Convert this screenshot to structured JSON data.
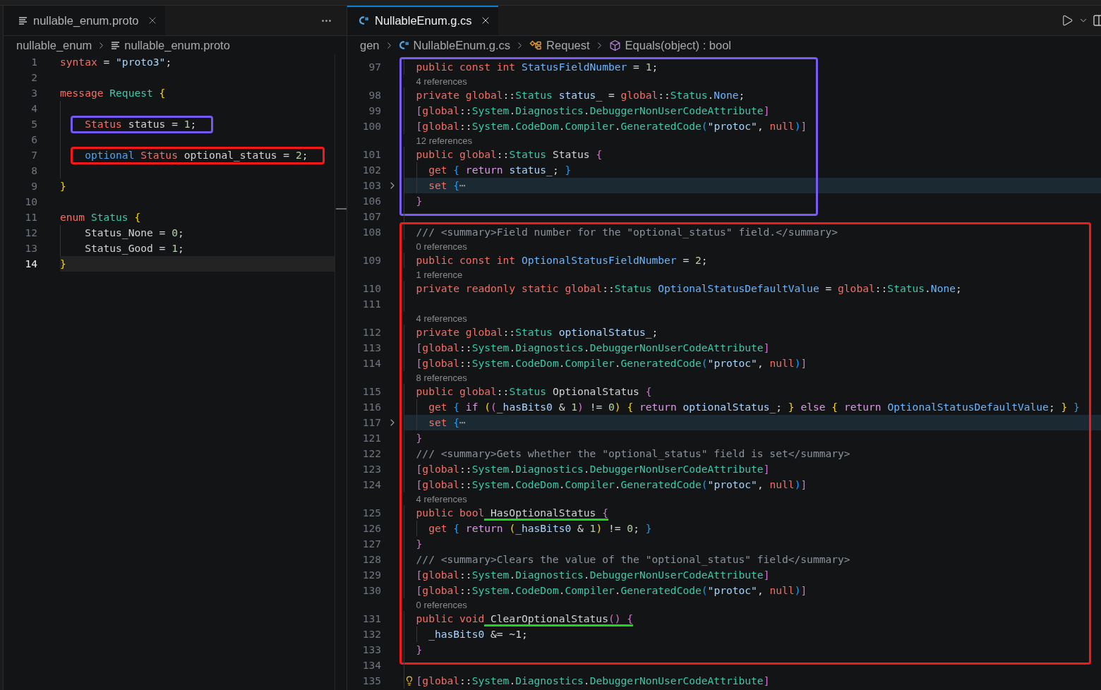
{
  "editor_groups": [
    {
      "focused": false,
      "tabs": [
        {
          "label": "nullable_enum.proto",
          "kind": "proto",
          "selected": true
        }
      ],
      "breadcrumbs": [
        {
          "label": "nullable_enum",
          "kind": "folder"
        },
        {
          "label": "nullable_enum.proto",
          "kind": "proto"
        }
      ],
      "sections": [
        {
          "lines": [
            {
              "number": "1",
              "tokens": [
                {
                  "kind": "keyword",
                  "text": "syntax"
                },
                {
                  "kind": "plain",
                  "text": " = "
                },
                {
                  "kind": "string",
                  "text": "\"proto3\""
                },
                {
                  "kind": "plain",
                  "text": ";"
                }
              ]
            },
            {
              "number": "2"
            },
            {
              "number": "3",
              "tokens": [
                {
                  "kind": "keyword",
                  "text": "message"
                },
                {
                  "kind": "type",
                  "text": " Request "
                },
                {
                  "kind": "bracket1",
                  "text": "{"
                }
              ],
              "children": [
                {
                  "number": "4"
                },
                {
                  "number": "5",
                  "color": "#7458f2",
                  "tokens": [
                    {
                      "kind": "keyword",
                      "text": "Status"
                    },
                    {
                      "kind": "plain",
                      "text": " status = "
                    },
                    {
                      "kind": "number",
                      "text": "1"
                    },
                    {
                      "kind": "plain",
                      "text": ";"
                    }
                  ]
                },
                {
                  "number": "6"
                },
                {
                  "number": "7",
                  "color": "#f51818",
                  "tokens": [
                    {
                      "kind": "modifier",
                      "text": "optional"
                    },
                    {
                      "kind": "keyword",
                      "text": " Status"
                    },
                    {
                      "kind": "plain",
                      "text": " optional_status = "
                    },
                    {
                      "kind": "number",
                      "text": "2"
                    },
                    {
                      "kind": "plain",
                      "text": ";"
                    }
                  ]
                },
                {
                  "number": "8"
                }
              ]
            },
            {
              "number": "9",
              "tokens": [
                {
                  "kind": "bracket1",
                  "text": "}"
                }
              ]
            },
            {
              "number": "10"
            },
            {
              "number": "11",
              "tokens": [
                {
                  "kind": "keyword",
                  "text": "enum"
                },
                {
                  "kind": "type",
                  "text": " Status "
                },
                {
                  "kind": "bracket1",
                  "text": "{"
                }
              ],
              "children": [
                {
                  "number": "12",
                  "tokens": [
                    {
                      "kind": "plain",
                      "text": "Status_None = "
                    },
                    {
                      "kind": "number",
                      "text": "0"
                    },
                    {
                      "kind": "plain",
                      "text": ";"
                    }
                  ]
                },
                {
                  "number": "13",
                  "tokens": [
                    {
                      "kind": "plain",
                      "text": "Status_Good = "
                    },
                    {
                      "kind": "number",
                      "text": "1"
                    },
                    {
                      "kind": "plain",
                      "text": ";"
                    }
                  ]
                }
              ]
            },
            {
              "number": "14",
              "current": true,
              "tokens": [
                {
                  "kind": "bracket1",
                  "text": "}"
                }
              ]
            }
          ]
        }
      ]
    },
    {
      "focused": true,
      "tabs": [
        {
          "label": "NullableEnum.g.cs",
          "kind": "csharp",
          "selected": true
        }
      ],
      "breadcrumbs": [
        {
          "label": "gen",
          "kind": "folder"
        },
        {
          "label": "NullableEnum.g.cs",
          "kind": "csharp"
        },
        {
          "label": "Request",
          "kind": "class"
        },
        {
          "label": "Equals(object) : bool",
          "kind": "method"
        }
      ],
      "in_block": true,
      "sections": [
        {
          "color": "#7a5cf5",
          "lines": [
            {
              "number": "97",
              "tokens": [
                {
                  "kind": "keyword",
                  "text": "public const int "
                },
                {
                  "kind": "member",
                  "text": "StatusFieldNumber"
                },
                {
                  "kind": "plain",
                  "text": " = "
                },
                {
                  "kind": "number",
                  "text": "1"
                },
                {
                  "kind": "plain",
                  "text": ";"
                }
              ]
            },
            {
              "number": "98",
              "references": "4 references",
              "tokens": [
                {
                  "kind": "keyword",
                  "text": "private global"
                },
                {
                  "kind": "plain",
                  "text": "::"
                },
                {
                  "kind": "type",
                  "text": "Status"
                },
                {
                  "kind": "field",
                  "text": " status_"
                },
                {
                  "kind": "plain",
                  "text": " = "
                },
                {
                  "kind": "keyword",
                  "text": "global"
                },
                {
                  "kind": "plain",
                  "text": "::"
                },
                {
                  "kind": "type",
                  "text": "Status"
                },
                {
                  "kind": "plain",
                  "text": "."
                },
                {
                  "kind": "member",
                  "text": "None"
                },
                {
                  "kind": "plain",
                  "text": ";"
                }
              ]
            },
            {
              "number": "99",
              "tokens": [
                {
                  "kind": "bracket2",
                  "text": "["
                },
                {
                  "kind": "keyword",
                  "text": "global"
                },
                {
                  "kind": "plain",
                  "text": "::"
                },
                {
                  "kind": "type",
                  "text": "System"
                },
                {
                  "kind": "plain",
                  "text": "."
                },
                {
                  "kind": "type",
                  "text": "Diagnostics"
                },
                {
                  "kind": "plain",
                  "text": "."
                },
                {
                  "kind": "type",
                  "text": "DebuggerNonUserCodeAttribute"
                },
                {
                  "kind": "bracket2",
                  "text": "]"
                }
              ]
            },
            {
              "number": "100",
              "tokens": [
                {
                  "kind": "bracket2",
                  "text": "["
                },
                {
                  "kind": "keyword",
                  "text": "global"
                },
                {
                  "kind": "plain",
                  "text": "::"
                },
                {
                  "kind": "type",
                  "text": "System"
                },
                {
                  "kind": "plain",
                  "text": "."
                },
                {
                  "kind": "type",
                  "text": "CodeDom"
                },
                {
                  "kind": "plain",
                  "text": "."
                },
                {
                  "kind": "type",
                  "text": "Compiler"
                },
                {
                  "kind": "plain",
                  "text": "."
                },
                {
                  "kind": "type",
                  "text": "GeneratedCode"
                },
                {
                  "kind": "bracket3",
                  "text": "("
                },
                {
                  "kind": "string",
                  "text": "\"protoc\""
                },
                {
                  "kind": "plain",
                  "text": ", "
                },
                {
                  "kind": "keyword",
                  "text": "null"
                },
                {
                  "kind": "bracket3",
                  "text": ")"
                },
                {
                  "kind": "bracket2",
                  "text": "]"
                }
              ]
            },
            {
              "number": "101",
              "references": "12 references",
              "tokens": [
                {
                  "kind": "keyword",
                  "text": "public global"
                },
                {
                  "kind": "plain",
                  "text": "::"
                },
                {
                  "kind": "type",
                  "text": "Status"
                },
                {
                  "kind": "plain",
                  "text": " Status "
                },
                {
                  "kind": "bracket2",
                  "text": "{"
                }
              ],
              "children": [
                {
                  "number": "102",
                  "tokens": [
                    {
                      "kind": "keyword",
                      "text": "get "
                    },
                    {
                      "kind": "bracket3",
                      "text": "{"
                    },
                    {
                      "kind": "control",
                      "text": " return"
                    },
                    {
                      "kind": "field",
                      "text": " status_"
                    },
                    {
                      "kind": "plain",
                      "text": "; "
                    },
                    {
                      "kind": "bracket3",
                      "text": "}"
                    }
                  ]
                },
                {
                  "number": "103",
                  "folded": true,
                  "tokens": [
                    {
                      "kind": "keyword",
                      "text": "set "
                    },
                    {
                      "kind": "bracket3",
                      "text": "{"
                    },
                    {
                      "kind": "fold",
                      "text": "⋯"
                    }
                  ]
                }
              ]
            },
            {
              "number": "106",
              "tokens": [
                {
                  "kind": "bracket2",
                  "text": "}"
                }
              ]
            }
          ]
        },
        {
          "lines": [
            {
              "number": "107"
            }
          ]
        },
        {
          "color": "#f51818",
          "lines": [
            {
              "number": "108",
              "tokens": [
                {
                  "kind": "comment",
                  "text": "/// <summary>Field number for the \"optional_status\" field.</summary>"
                }
              ]
            },
            {
              "number": "109",
              "references": "0 references",
              "tokens": [
                {
                  "kind": "keyword",
                  "text": "public const int "
                },
                {
                  "kind": "member",
                  "text": "OptionalStatusFieldNumber"
                },
                {
                  "kind": "plain",
                  "text": " = "
                },
                {
                  "kind": "number",
                  "text": "2"
                },
                {
                  "kind": "plain",
                  "text": ";"
                }
              ]
            },
            {
              "number": "110",
              "references": "1 reference",
              "tokens": [
                {
                  "kind": "keyword",
                  "text": "private readonly static global"
                },
                {
                  "kind": "plain",
                  "text": "::"
                },
                {
                  "kind": "type",
                  "text": "Status"
                },
                {
                  "kind": "member",
                  "text": " OptionalStatusDefaultValue"
                },
                {
                  "kind": "plain",
                  "text": " = "
                },
                {
                  "kind": "keyword",
                  "text": "global"
                },
                {
                  "kind": "plain",
                  "text": "::"
                },
                {
                  "kind": "type",
                  "text": "Status"
                },
                {
                  "kind": "plain",
                  "text": "."
                },
                {
                  "kind": "member",
                  "text": "None"
                },
                {
                  "kind": "plain",
                  "text": ";"
                }
              ]
            },
            {
              "number": "111"
            },
            {
              "number": "112",
              "references": "4 references",
              "tokens": [
                {
                  "kind": "keyword",
                  "text": "private global"
                },
                {
                  "kind": "plain",
                  "text": "::"
                },
                {
                  "kind": "type",
                  "text": "Status"
                },
                {
                  "kind": "field",
                  "text": " optionalStatus_"
                },
                {
                  "kind": "plain",
                  "text": ";"
                }
              ]
            },
            {
              "number": "113",
              "tokens": [
                {
                  "kind": "bracket2",
                  "text": "["
                },
                {
                  "kind": "keyword",
                  "text": "global"
                },
                {
                  "kind": "plain",
                  "text": "::"
                },
                {
                  "kind": "type",
                  "text": "System"
                },
                {
                  "kind": "plain",
                  "text": "."
                },
                {
                  "kind": "type",
                  "text": "Diagnostics"
                },
                {
                  "kind": "plain",
                  "text": "."
                },
                {
                  "kind": "type",
                  "text": "DebuggerNonUserCodeAttribute"
                },
                {
                  "kind": "bracket2",
                  "text": "]"
                }
              ]
            },
            {
              "number": "114",
              "tokens": [
                {
                  "kind": "bracket2",
                  "text": "["
                },
                {
                  "kind": "keyword",
                  "text": "global"
                },
                {
                  "kind": "plain",
                  "text": "::"
                },
                {
                  "kind": "type",
                  "text": "System"
                },
                {
                  "kind": "plain",
                  "text": "."
                },
                {
                  "kind": "type",
                  "text": "CodeDom"
                },
                {
                  "kind": "plain",
                  "text": "."
                },
                {
                  "kind": "type",
                  "text": "Compiler"
                },
                {
                  "kind": "plain",
                  "text": "."
                },
                {
                  "kind": "type",
                  "text": "GeneratedCode"
                },
                {
                  "kind": "bracket3",
                  "text": "("
                },
                {
                  "kind": "string",
                  "text": "\"protoc\""
                },
                {
                  "kind": "plain",
                  "text": ", "
                },
                {
                  "kind": "keyword",
                  "text": "null"
                },
                {
                  "kind": "bracket3",
                  "text": ")"
                },
                {
                  "kind": "bracket2",
                  "text": "]"
                }
              ]
            },
            {
              "number": "115",
              "references": "8 references",
              "tokens": [
                {
                  "kind": "keyword",
                  "text": "public global"
                },
                {
                  "kind": "plain",
                  "text": "::"
                },
                {
                  "kind": "type",
                  "text": "Status"
                },
                {
                  "kind": "plain",
                  "text": " OptionalStatus "
                },
                {
                  "kind": "bracket2",
                  "text": "{"
                }
              ],
              "children": [
                {
                  "number": "116",
                  "tokens": [
                    {
                      "kind": "keyword",
                      "text": "get "
                    },
                    {
                      "kind": "bracket3",
                      "text": "{"
                    },
                    {
                      "kind": "control",
                      "text": " if "
                    },
                    {
                      "kind": "bracket1",
                      "text": "("
                    },
                    {
                      "kind": "bracket2",
                      "text": "("
                    },
                    {
                      "kind": "field",
                      "text": "_hasBits0"
                    },
                    {
                      "kind": "plain",
                      "text": " & "
                    },
                    {
                      "kind": "number",
                      "text": "1"
                    },
                    {
                      "kind": "bracket2",
                      "text": ")"
                    },
                    {
                      "kind": "plain",
                      "text": " != "
                    },
                    {
                      "kind": "number",
                      "text": "0"
                    },
                    {
                      "kind": "bracket1",
                      "text": ") {"
                    },
                    {
                      "kind": "control",
                      "text": " return "
                    },
                    {
                      "kind": "field",
                      "text": "optionalStatus_"
                    },
                    {
                      "kind": "plain",
                      "text": "; "
                    },
                    {
                      "kind": "bracket1",
                      "text": "}"
                    },
                    {
                      "kind": "control",
                      "text": " else "
                    },
                    {
                      "kind": "bracket1",
                      "text": "{"
                    },
                    {
                      "kind": "control",
                      "text": " return "
                    },
                    {
                      "kind": "member",
                      "text": "OptionalStatusDefaultValue"
                    },
                    {
                      "kind": "plain",
                      "text": "; "
                    },
                    {
                      "kind": "bracket1",
                      "text": "} "
                    },
                    {
                      "kind": "bracket3",
                      "text": "}"
                    }
                  ]
                },
                {
                  "number": "117",
                  "folded": true,
                  "tokens": [
                    {
                      "kind": "keyword",
                      "text": "set "
                    },
                    {
                      "kind": "bracket3",
                      "text": "{"
                    },
                    {
                      "kind": "fold",
                      "text": "⋯"
                    }
                  ]
                }
              ]
            },
            {
              "number": "121",
              "tokens": [
                {
                  "kind": "bracket2",
                  "text": "}"
                }
              ]
            },
            {
              "number": "122",
              "tokens": [
                {
                  "kind": "comment",
                  "text": "/// <summary>Gets whether the \"optional_status\" field is set</summary>"
                }
              ]
            },
            {
              "number": "123",
              "tokens": [
                {
                  "kind": "bracket2",
                  "text": "["
                },
                {
                  "kind": "keyword",
                  "text": "global"
                },
                {
                  "kind": "plain",
                  "text": "::"
                },
                {
                  "kind": "type",
                  "text": "System"
                },
                {
                  "kind": "plain",
                  "text": "."
                },
                {
                  "kind": "type",
                  "text": "Diagnostics"
                },
                {
                  "kind": "plain",
                  "text": "."
                },
                {
                  "kind": "type",
                  "text": "DebuggerNonUserCodeAttribute"
                },
                {
                  "kind": "bracket2",
                  "text": "]"
                }
              ]
            },
            {
              "number": "124",
              "tokens": [
                {
                  "kind": "bracket2",
                  "text": "["
                },
                {
                  "kind": "keyword",
                  "text": "global"
                },
                {
                  "kind": "plain",
                  "text": "::"
                },
                {
                  "kind": "type",
                  "text": "System"
                },
                {
                  "kind": "plain",
                  "text": "."
                },
                {
                  "kind": "type",
                  "text": "CodeDom"
                },
                {
                  "kind": "plain",
                  "text": "."
                },
                {
                  "kind": "type",
                  "text": "Compiler"
                },
                {
                  "kind": "plain",
                  "text": "."
                },
                {
                  "kind": "type",
                  "text": "GeneratedCode"
                },
                {
                  "kind": "bracket3",
                  "text": "("
                },
                {
                  "kind": "string",
                  "text": "\"protoc\""
                },
                {
                  "kind": "plain",
                  "text": ", "
                },
                {
                  "kind": "keyword",
                  "text": "null"
                },
                {
                  "kind": "bracket3",
                  "text": ")"
                },
                {
                  "kind": "bracket2",
                  "text": "]"
                }
              ]
            },
            {
              "number": "125",
              "references": "4 references",
              "tokens": [
                {
                  "kind": "keyword",
                  "text": "public bool"
                },
                {
                  "kind": "plain",
                  "text": " HasOptionalStatus ",
                  "underlined": true
                },
                {
                  "kind": "bracket2",
                  "text": "{",
                  "underlined": true
                }
              ],
              "children": [
                {
                  "number": "126",
                  "tokens": [
                    {
                      "kind": "keyword",
                      "text": "get "
                    },
                    {
                      "kind": "bracket3",
                      "text": "{"
                    },
                    {
                      "kind": "control",
                      "text": " return "
                    },
                    {
                      "kind": "bracket1",
                      "text": "("
                    },
                    {
                      "kind": "field",
                      "text": "_hasBits0"
                    },
                    {
                      "kind": "plain",
                      "text": " & "
                    },
                    {
                      "kind": "number",
                      "text": "1"
                    },
                    {
                      "kind": "bracket1",
                      "text": ")"
                    },
                    {
                      "kind": "plain",
                      "text": " != "
                    },
                    {
                      "kind": "number",
                      "text": "0"
                    },
                    {
                      "kind": "plain",
                      "text": "; "
                    },
                    {
                      "kind": "bracket3",
                      "text": "}"
                    }
                  ]
                }
              ]
            },
            {
              "number": "127",
              "tokens": [
                {
                  "kind": "bracket2",
                  "text": "}"
                }
              ]
            },
            {
              "number": "128",
              "tokens": [
                {
                  "kind": "comment",
                  "text": "/// <summary>Clears the value of the \"optional_status\" field</summary>"
                }
              ]
            },
            {
              "number": "129",
              "tokens": [
                {
                  "kind": "bracket2",
                  "text": "["
                },
                {
                  "kind": "keyword",
                  "text": "global"
                },
                {
                  "kind": "plain",
                  "text": "::"
                },
                {
                  "kind": "type",
                  "text": "System"
                },
                {
                  "kind": "plain",
                  "text": "."
                },
                {
                  "kind": "type",
                  "text": "Diagnostics"
                },
                {
                  "kind": "plain",
                  "text": "."
                },
                {
                  "kind": "type",
                  "text": "DebuggerNonUserCodeAttribute"
                },
                {
                  "kind": "bracket2",
                  "text": "]"
                }
              ]
            },
            {
              "number": "130",
              "tokens": [
                {
                  "kind": "bracket2",
                  "text": "["
                },
                {
                  "kind": "keyword",
                  "text": "global"
                },
                {
                  "kind": "plain",
                  "text": "::"
                },
                {
                  "kind": "type",
                  "text": "System"
                },
                {
                  "kind": "plain",
                  "text": "."
                },
                {
                  "kind": "type",
                  "text": "CodeDom"
                },
                {
                  "kind": "plain",
                  "text": "."
                },
                {
                  "kind": "type",
                  "text": "Compiler"
                },
                {
                  "kind": "plain",
                  "text": "."
                },
                {
                  "kind": "type",
                  "text": "GeneratedCode"
                },
                {
                  "kind": "bracket3",
                  "text": "("
                },
                {
                  "kind": "string",
                  "text": "\"protoc\""
                },
                {
                  "kind": "plain",
                  "text": ", "
                },
                {
                  "kind": "keyword",
                  "text": "null"
                },
                {
                  "kind": "bracket3",
                  "text": ")"
                },
                {
                  "kind": "bracket2",
                  "text": "]"
                }
              ]
            },
            {
              "number": "131",
              "references": "0 references",
              "tokens": [
                {
                  "kind": "keyword",
                  "text": "public void"
                },
                {
                  "kind": "plain",
                  "text": " ClearOptionalStatus",
                  "underlined": true
                },
                {
                  "kind": "bracket2",
                  "text": "() {",
                  "underlined": true
                }
              ],
              "children": [
                {
                  "number": "132",
                  "tokens": [
                    {
                      "kind": "field",
                      "text": "_hasBits0"
                    },
                    {
                      "kind": "plain",
                      "text": " &= ~1;"
                    }
                  ]
                }
              ]
            },
            {
              "number": "133",
              "tokens": [
                {
                  "kind": "bracket2",
                  "text": "}"
                }
              ]
            }
          ]
        },
        {
          "lines": [
            {
              "number": "134"
            },
            {
              "number": "135",
              "lightbulb": true,
              "tokens": [
                {
                  "kind": "bracket2",
                  "text": "["
                },
                {
                  "kind": "keyword",
                  "text": "global"
                },
                {
                  "kind": "plain",
                  "text": "::"
                },
                {
                  "kind": "type",
                  "text": "System"
                },
                {
                  "kind": "plain",
                  "text": "."
                },
                {
                  "kind": "type",
                  "text": "Diagnostics"
                },
                {
                  "kind": "plain",
                  "text": "."
                },
                {
                  "kind": "type",
                  "text": "DebuggerNonUserCodeAttribute"
                },
                {
                  "kind": "bracket2",
                  "text": "]"
                }
              ]
            }
          ]
        }
      ]
    }
  ]
}
